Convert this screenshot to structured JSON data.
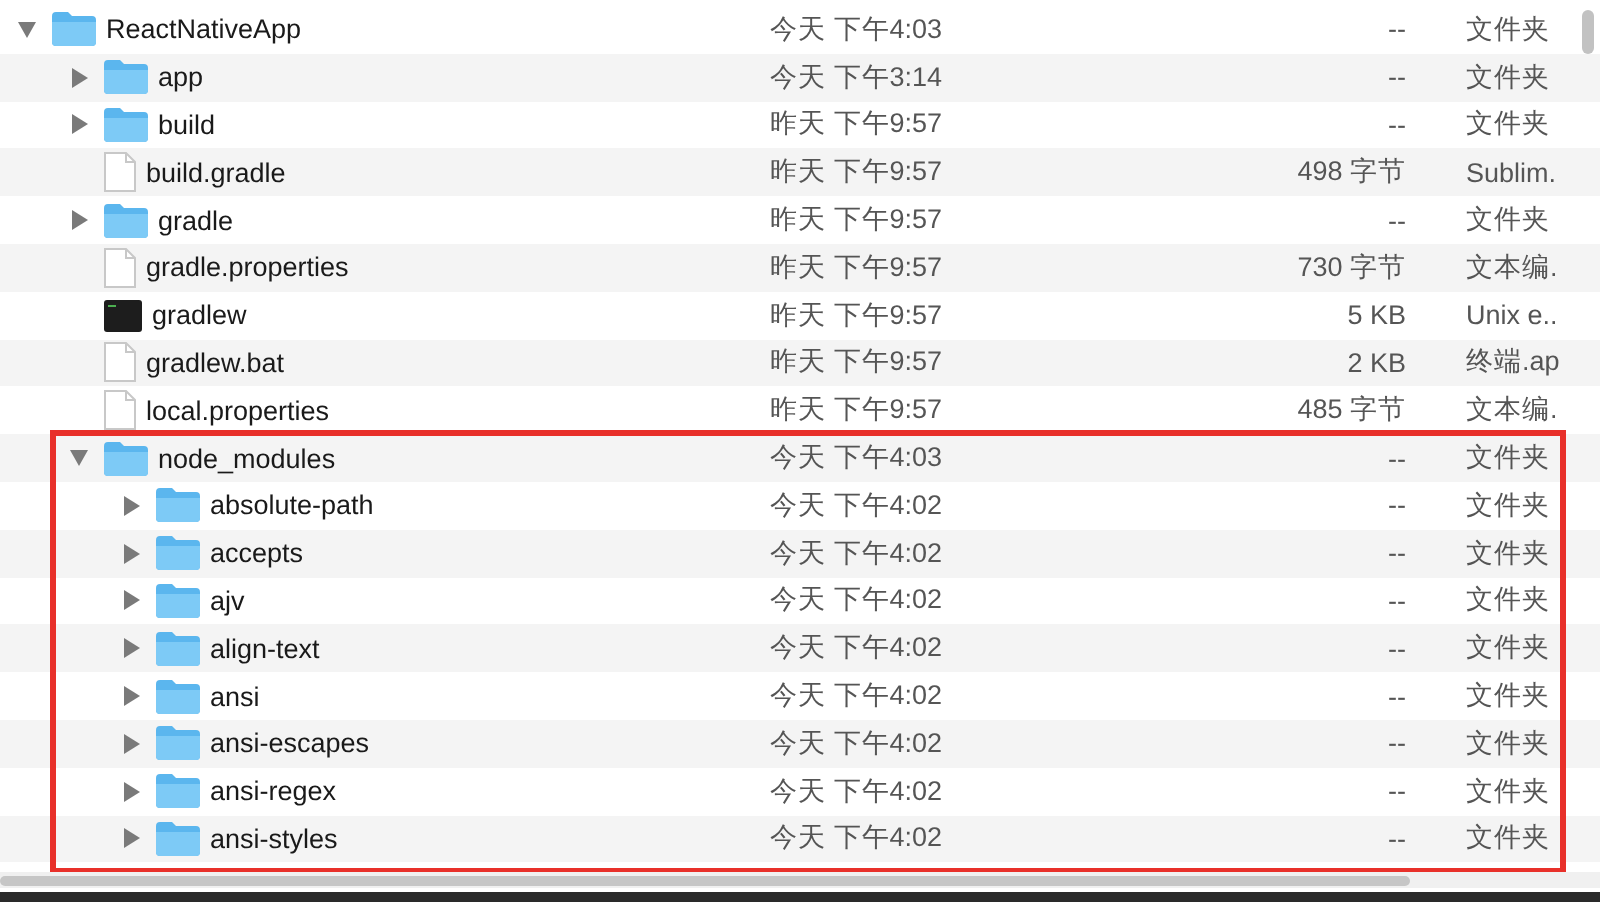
{
  "tree": [
    {
      "name": "ReactNativeApp",
      "kind": "folder",
      "expanded": true,
      "date": "今天 下午4:03",
      "size": "--",
      "file_type": "文件夹",
      "children": [
        {
          "name": "app",
          "kind": "folder",
          "expanded": false,
          "date": "今天 下午3:14",
          "size": "--",
          "file_type": "文件夹"
        },
        {
          "name": "build",
          "kind": "folder",
          "expanded": false,
          "date": "昨天 下午9:57",
          "size": "--",
          "file_type": "文件夹"
        },
        {
          "name": "build.gradle",
          "kind": "file",
          "date": "昨天 下午9:57",
          "size": "498 字节",
          "file_type": "Sublim."
        },
        {
          "name": "gradle",
          "kind": "folder",
          "expanded": false,
          "date": "昨天 下午9:57",
          "size": "--",
          "file_type": "文件夹"
        },
        {
          "name": "gradle.properties",
          "kind": "file",
          "date": "昨天 下午9:57",
          "size": "730 字节",
          "file_type": "文本编."
        },
        {
          "name": "gradlew",
          "kind": "executable",
          "date": "昨天 下午9:57",
          "size": "5 KB",
          "file_type": "Unix e.."
        },
        {
          "name": "gradlew.bat",
          "kind": "file",
          "date": "昨天 下午9:57",
          "size": "2 KB",
          "file_type": "终端.ap"
        },
        {
          "name": "local.properties",
          "kind": "file",
          "date": "昨天 下午9:57",
          "size": "485 字节",
          "file_type": "文本编."
        },
        {
          "name": "node_modules",
          "kind": "folder",
          "expanded": true,
          "highlighted": true,
          "date": "今天 下午4:03",
          "size": "--",
          "file_type": "文件夹",
          "children": [
            {
              "name": "absolute-path",
              "kind": "folder",
              "expanded": false,
              "date": "今天 下午4:02",
              "size": "--",
              "file_type": "文件夹"
            },
            {
              "name": "accepts",
              "kind": "folder",
              "expanded": false,
              "date": "今天 下午4:02",
              "size": "--",
              "file_type": "文件夹"
            },
            {
              "name": "ajv",
              "kind": "folder",
              "expanded": false,
              "date": "今天 下午4:02",
              "size": "--",
              "file_type": "文件夹"
            },
            {
              "name": "align-text",
              "kind": "folder",
              "expanded": false,
              "date": "今天 下午4:02",
              "size": "--",
              "file_type": "文件夹"
            },
            {
              "name": "ansi",
              "kind": "folder",
              "expanded": false,
              "date": "今天 下午4:02",
              "size": "--",
              "file_type": "文件夹"
            },
            {
              "name": "ansi-escapes",
              "kind": "folder",
              "expanded": false,
              "date": "今天 下午4:02",
              "size": "--",
              "file_type": "文件夹"
            },
            {
              "name": "ansi-regex",
              "kind": "folder",
              "expanded": false,
              "date": "今天 下午4:02",
              "size": "--",
              "file_type": "文件夹"
            },
            {
              "name": "ansi-styles",
              "kind": "folder",
              "expanded": false,
              "date": "今天 下午4:02",
              "size": "--",
              "file_type": "文件夹"
            }
          ]
        }
      ]
    }
  ]
}
